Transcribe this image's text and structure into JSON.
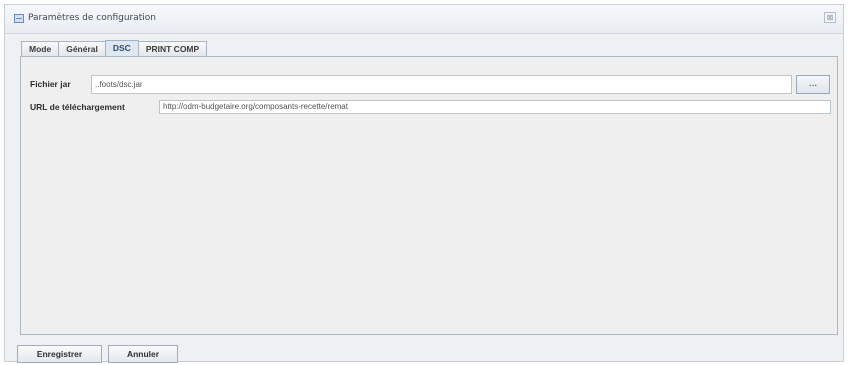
{
  "window": {
    "title": "Paramètres de configuration",
    "close_glyph": "⊠"
  },
  "tabs": [
    {
      "label": "Mode",
      "active": false
    },
    {
      "label": "Général",
      "active": false
    },
    {
      "label": "DSC",
      "active": true
    },
    {
      "label": "PRINT COMP",
      "active": false
    }
  ],
  "form": {
    "jar_label": "Fichier jar",
    "jar_value": "..foots/dsc.jar",
    "browse_label": "...",
    "url_label": "URL de téléchargement",
    "url_value": "http://odm-budgetaire.org/composants-recette/remat"
  },
  "buttons": {
    "save_label": "Enregistrer",
    "cancel_label": "Annuler"
  },
  "icons": {
    "app": "config-window-icon",
    "close": "close-icon"
  },
  "colors": {
    "active_tab": "#dfe8f2",
    "panel_bg": "#efefef",
    "window_bg": "#eef0f2"
  }
}
